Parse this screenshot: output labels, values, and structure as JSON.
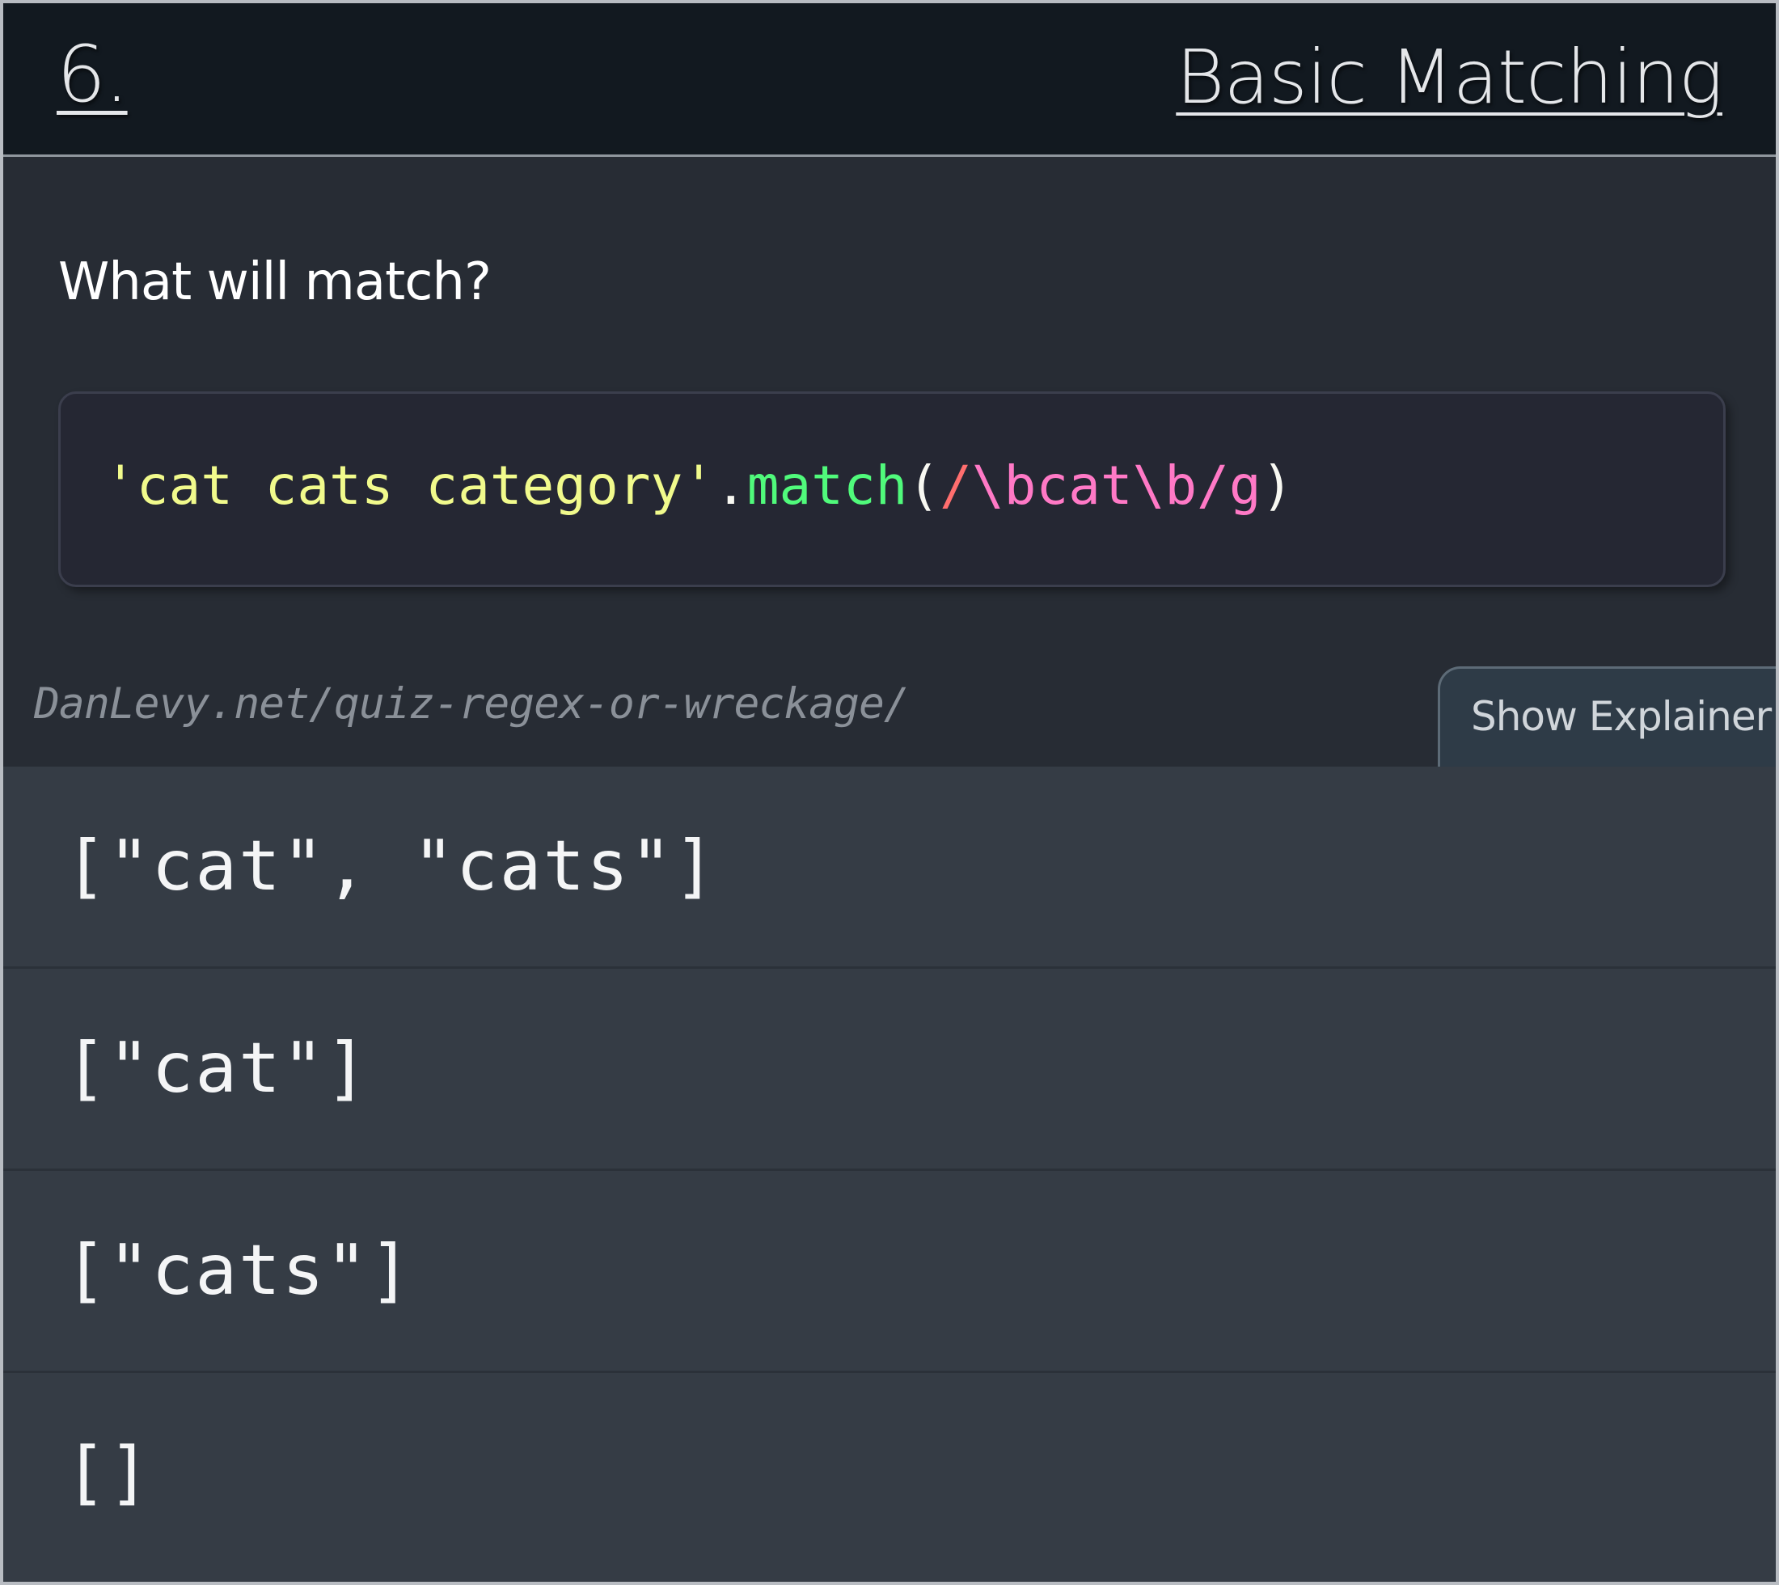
{
  "header": {
    "number": "6.",
    "title": "Basic Matching"
  },
  "question": {
    "prompt": "What will match?",
    "code": {
      "string_literal": "'cat cats category'",
      "dot": ".",
      "method": "match",
      "open_paren": "(",
      "regex_open_slash": "/",
      "regex_body_1": "\\bcat",
      "regex_body_2": "\\b",
      "regex_close_slash": "/",
      "regex_flag": "g",
      "close_paren": ")"
    }
  },
  "source_link": "DanLevy.net/quiz-regex-or-wreckage/",
  "explainer_button": "Show Explainer",
  "answers": [
    {
      "text": "[\"cat\", \"cats\"]"
    },
    {
      "text": "[\"cat\"]"
    },
    {
      "text": "[\"cats\"]"
    },
    {
      "text": "[]"
    }
  ],
  "colors": {
    "header_bg": "#121920",
    "page_bg": "#272c34",
    "code_bg": "#252733",
    "answers_bg": "#353c45",
    "string": "#f1fa8c",
    "method": "#50fa7b",
    "regex": "#ff79c6",
    "regex_slash": "#ff6e6e"
  }
}
